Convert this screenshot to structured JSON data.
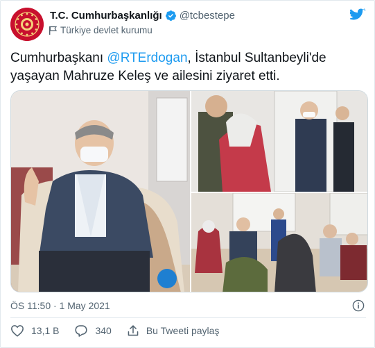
{
  "author": {
    "display_name": "T.C. Cumhurbaşkanlığı",
    "handle": "@tcbestepe",
    "account_label": "Türkiye devlet kurumu"
  },
  "tweet": {
    "text_before_mention": "Cumhurbaşkanı ",
    "mention": "@RTErdogan",
    "text_after_mention": ", İstanbul Sultanbeyli'de yaşayan Mahruze Keleş ve ailesini ziyaret etti.",
    "timestamp": "ÖS 11:50 · 1 May 2021"
  },
  "actions": {
    "like_count": "13,1 B",
    "reply_count": "340",
    "share_label": "Bu Tweeti paylaş"
  },
  "icons": {
    "avatar": "presidential-seal-icon",
    "verified": "verified-badge-icon",
    "label": "government-flag-icon",
    "brand": "twitter-bird-icon",
    "info": "info-icon",
    "like": "heart-icon",
    "reply": "comment-icon",
    "share": "share-icon"
  },
  "colors": {
    "accent": "#1d9bf0",
    "seal_red": "#c8102e",
    "text_secondary": "#536471"
  }
}
